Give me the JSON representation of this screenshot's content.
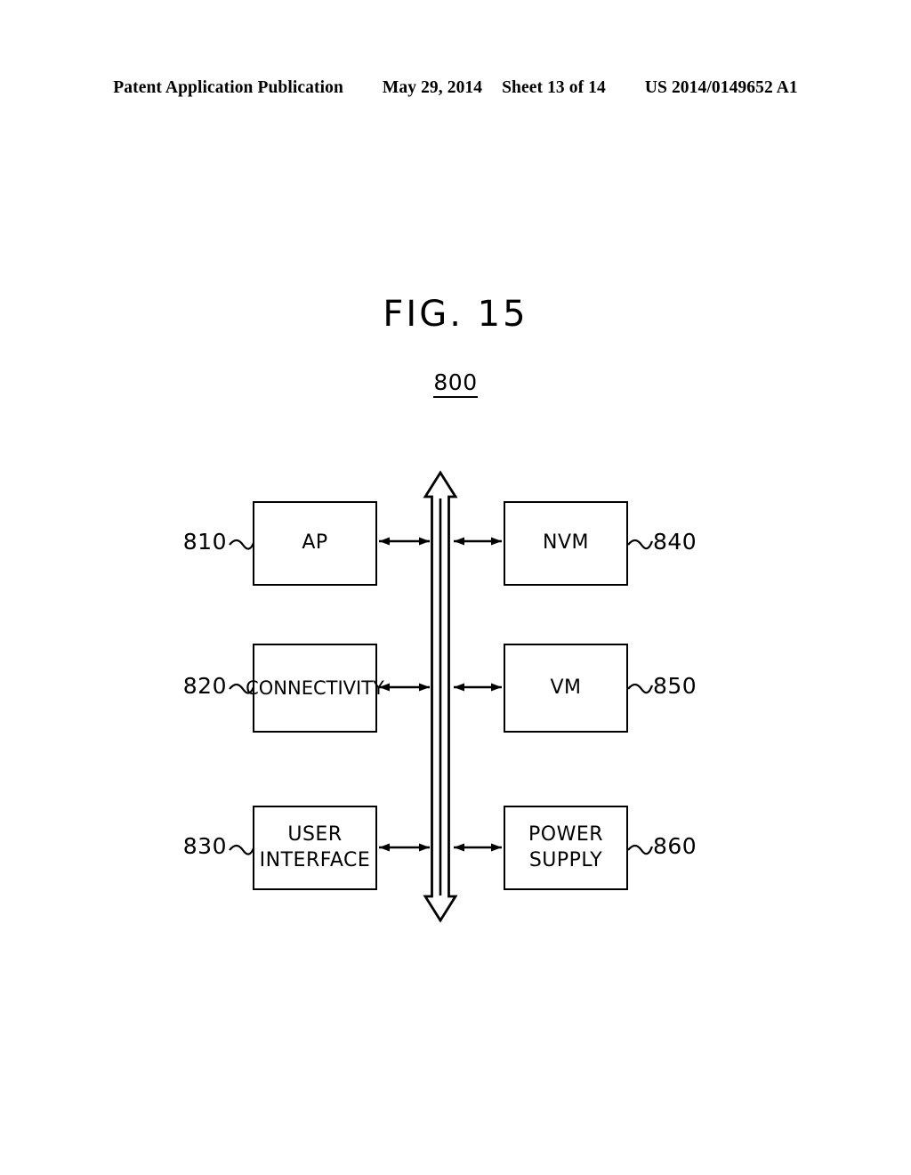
{
  "header": {
    "publication": "Patent Application Publication",
    "date": "May 29, 2014",
    "sheet": "Sheet 13 of 14",
    "patent_number": "US 2014/0149652 A1"
  },
  "figure": {
    "title": "FIG. 15",
    "reference_numeral": "800"
  },
  "diagram": {
    "bus_label": "system-bus",
    "blocks": [
      {
        "id": "ap",
        "lines": [
          "AP"
        ],
        "ref": "810",
        "ref_side": "left"
      },
      {
        "id": "connectivity",
        "lines": [
          "CONNECTIVITY"
        ],
        "ref": "820",
        "ref_side": "left"
      },
      {
        "id": "user_interface",
        "lines": [
          "USER",
          "INTERFACE"
        ],
        "ref": "830",
        "ref_side": "left"
      },
      {
        "id": "nvm",
        "lines": [
          "NVM"
        ],
        "ref": "840",
        "ref_side": "right"
      },
      {
        "id": "vm",
        "lines": [
          "VM"
        ],
        "ref": "850",
        "ref_side": "right"
      },
      {
        "id": "power_supply",
        "lines": [
          "POWER",
          "SUPPLY"
        ],
        "ref": "860",
        "ref_side": "right"
      }
    ]
  },
  "colors": {
    "ink": "#000000",
    "paper": "#ffffff"
  }
}
